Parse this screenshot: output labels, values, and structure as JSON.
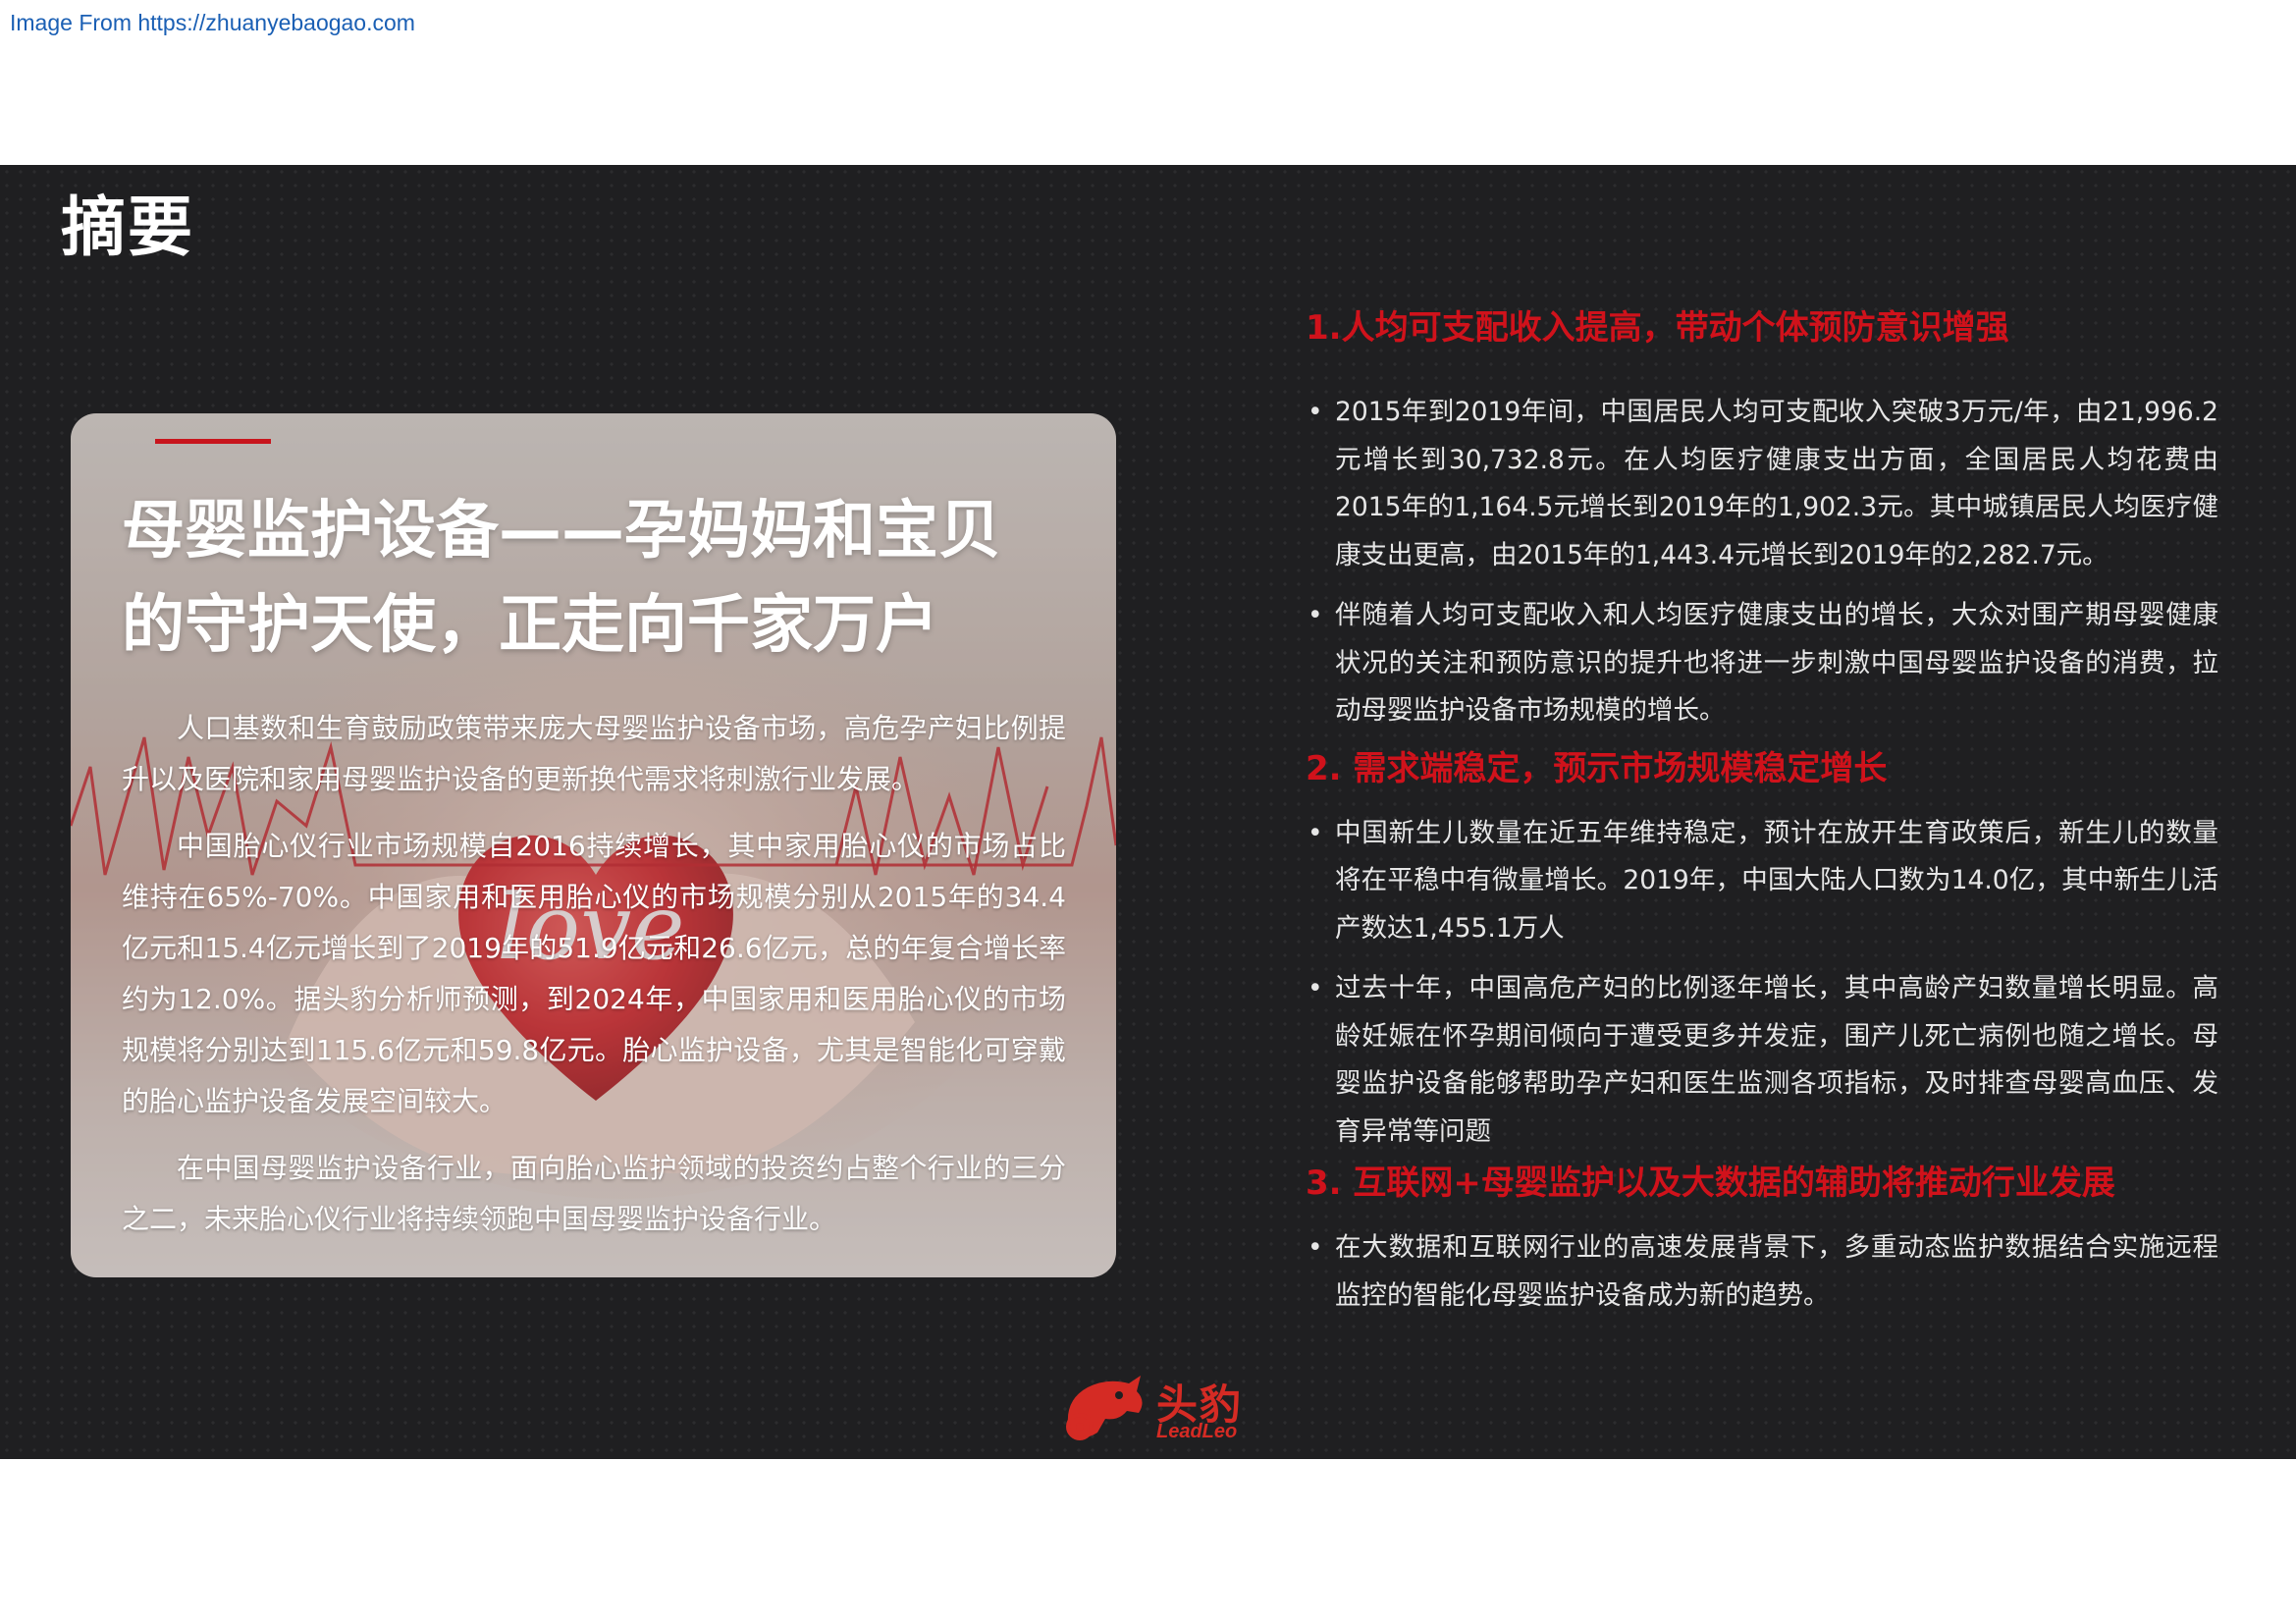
{
  "source_link": "Image From https://zhuanyebaogao.com",
  "slide": {
    "title": "摘要",
    "card": {
      "heading_lines": [
        "母婴监护设备——孕妈妈和宝贝",
        "的守护天使，正走向千家万户"
      ],
      "image_text": "love",
      "paragraphs": [
        "人口基数和生育鼓励政策带来庞大母婴监护设备市场，高危孕产妇比例提升以及医院和家用母婴监护设备的更新换代需求将刺激行业发展。",
        "中国胎心仪行业市场规模自2016持续增长，其中家用胎心仪的市场占比维持在65%-70%。中国家用和医用胎心仪的市场规模分别从2015年的34.4亿元和15.4亿元增长到了2019年的51.9亿元和26.6亿元，总的年复合增长率约为12.0%。据头豹分析师预测，到2024年，中国家用和医用胎心仪的市场规模将分别达到115.6亿元和59.8亿元。胎心监护设备，尤其是智能化可穿戴的胎心监护设备发展空间较大。",
        "在中国母婴监护设备行业，面向胎心监护领域的投资约占整个行业的三分之二，未来胎心仪行业将持续领跑中国母婴监护设备行业。"
      ]
    },
    "sections": [
      {
        "heading": "1.人均可支配收入提高，带动个体预防意识增强",
        "bullets": [
          "2015年到2019年间，中国居民人均可支配收入突破3万元/年，由21,996.2元增长到30,732.8元。在人均医疗健康支出方面，全国居民人均花费由2015年的1,164.5元增长到2019年的1,902.3元。其中城镇居民人均医疗健康支出更高，由2015年的1,443.4元增长到2019年的2,282.7元。",
          "伴随着人均可支配收入和人均医疗健康支出的增长，大众对围产期母婴健康状况的关注和预防意识的提升也将进一步刺激中国母婴监护设备的消费，拉动母婴监护设备市场规模的增长。"
        ]
      },
      {
        "heading": "2. 需求端稳定，预示市场规模稳定增长",
        "bullets": [
          "中国新生儿数量在近五年维持稳定，预计在放开生育政策后，新生儿的数量将在平稳中有微量增长。2019年，中国大陆人口数为14.0亿，其中新生儿活产数达1,455.1万人",
          "过去十年，中国高危产妇的比例逐年增长，其中高龄产妇数量增长明显。高龄妊娠在怀孕期间倾向于遭受更多并发症，围产儿死亡病例也随之增长。母婴监护设备能够帮助孕产妇和医生监测各项指标，及时排查母婴高血压、发育异常等问题"
        ]
      },
      {
        "heading": "3. 互联网+母婴监护以及大数据的辅助将推动行业发展",
        "bullets": [
          "在大数据和互联网行业的高速发展背景下，多重动态监护数据结合实施远程监控的智能化母婴监护设备成为新的趋势。"
        ]
      }
    ],
    "logo": {
      "cn": "头豹",
      "en": "LeadLeo"
    }
  }
}
